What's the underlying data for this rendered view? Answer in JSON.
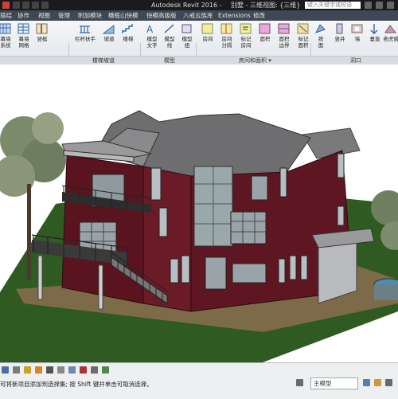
{
  "titlebar": {
    "app_title": "Autodesk Revit 2016 -",
    "view_name": "别墅 - 三维视图: {三维}",
    "search_placeholder": "键入关键字或短语"
  },
  "tabs": [
    {
      "label": "插结"
    },
    {
      "label": "协作"
    },
    {
      "label": "视图"
    },
    {
      "label": "管理"
    },
    {
      "label": "附加模块"
    },
    {
      "label": "橄榄山快模"
    },
    {
      "label": "快模高级版"
    },
    {
      "label": "八戒云族库"
    },
    {
      "label": "Extensions"
    },
    {
      "label": "修改"
    }
  ],
  "ribbon": {
    "buttons": [
      {
        "label": "幕墙\n系统"
      },
      {
        "label": "幕墙\n网格"
      },
      {
        "label": "竖梃"
      },
      {
        "label": "栏杆扶手"
      },
      {
        "label": "坡道"
      },
      {
        "label": "楼梯"
      },
      {
        "label": "模型\n文字"
      },
      {
        "label": "模型\n线"
      },
      {
        "label": "模型\n组"
      },
      {
        "label": "房间"
      },
      {
        "label": "房间\n分隔"
      },
      {
        "label": "标记\n房间"
      },
      {
        "label": "面积"
      },
      {
        "label": "面积\n边界"
      },
      {
        "label": "标记\n面积"
      },
      {
        "label": "按\n面"
      },
      {
        "label": "竖井"
      },
      {
        "label": "墙"
      },
      {
        "label": "垂直"
      },
      {
        "label": "老虎窗"
      }
    ],
    "panels": [
      {
        "label": "楼梯坡道"
      },
      {
        "label": "模型"
      },
      {
        "label": "房间和面积 ▾"
      },
      {
        "label": "洞口"
      }
    ]
  },
  "status": {
    "message": "可将新项目添加到选择集; 按 Shift 键并单击可取消选择。",
    "model_label": "主模型"
  },
  "colors": {
    "title_bg": "#1b1b1d",
    "tab_bg": "#3e4753",
    "wall": "#5a1420",
    "roof": "#6e6e70"
  }
}
